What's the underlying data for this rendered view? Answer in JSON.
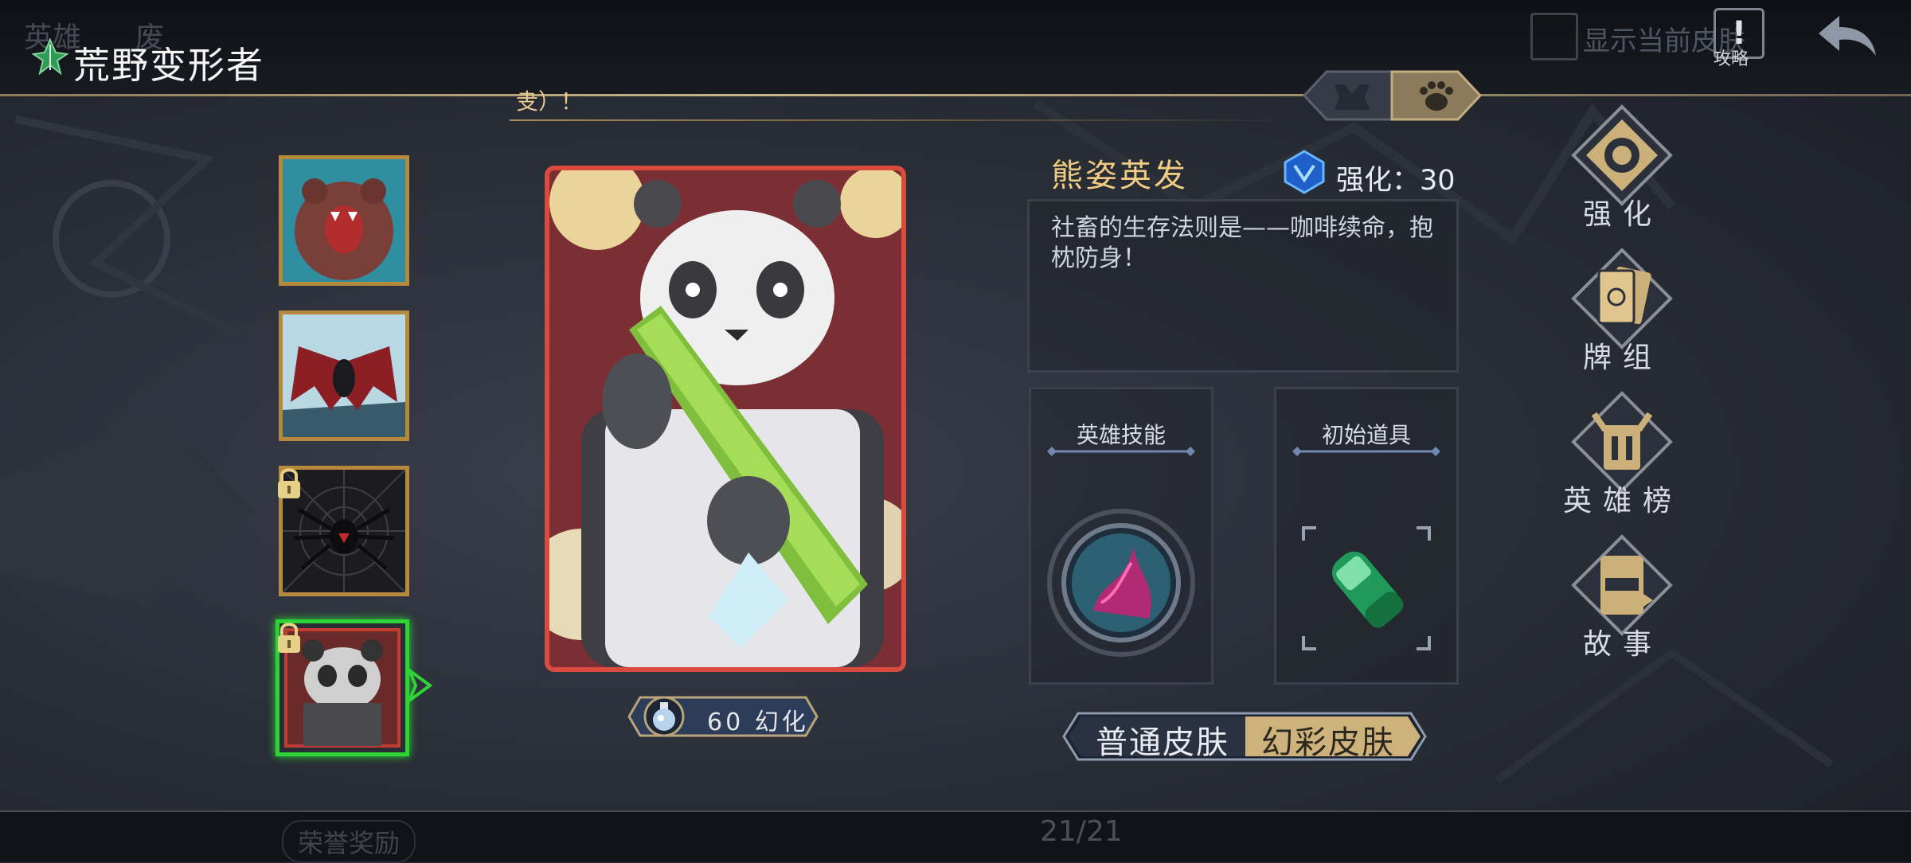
{
  "header": {
    "title": "荒野变形者",
    "faint_tab_1": "英雄",
    "faint_tab_2": "废",
    "announcement": "叏）！",
    "show_current_skin_label": "显示当前皮肤",
    "guide_label": "攻略"
  },
  "skins": {
    "total_indicator": "21/21"
  },
  "detail": {
    "skin_name": "熊姿英发",
    "enhance_label": "强化：30",
    "description": "社畜的生存法则是——咖啡续命，抱枕防身！",
    "skill_title": "英雄技能",
    "item_title": "初始道具",
    "price_label": "60 幻化",
    "skin_toggle": {
      "normal": "普通皮肤",
      "illusion": "幻彩皮肤",
      "selected": "illusion"
    }
  },
  "side_menu": [
    {
      "label": "强化",
      "icon": "enhance-compass-icon"
    },
    {
      "label": "牌组",
      "icon": "deck-cards-icon"
    },
    {
      "label": "英雄榜",
      "icon": "hero-ranking-icon"
    },
    {
      "label": "故事",
      "icon": "story-book-icon"
    }
  ],
  "bottom": {
    "honor_reward": "荣誉奖励"
  },
  "colors": {
    "accent_gold": "#f0cc82",
    "selected_green": "#2ed336",
    "card_border_red": "#d94b3c"
  }
}
